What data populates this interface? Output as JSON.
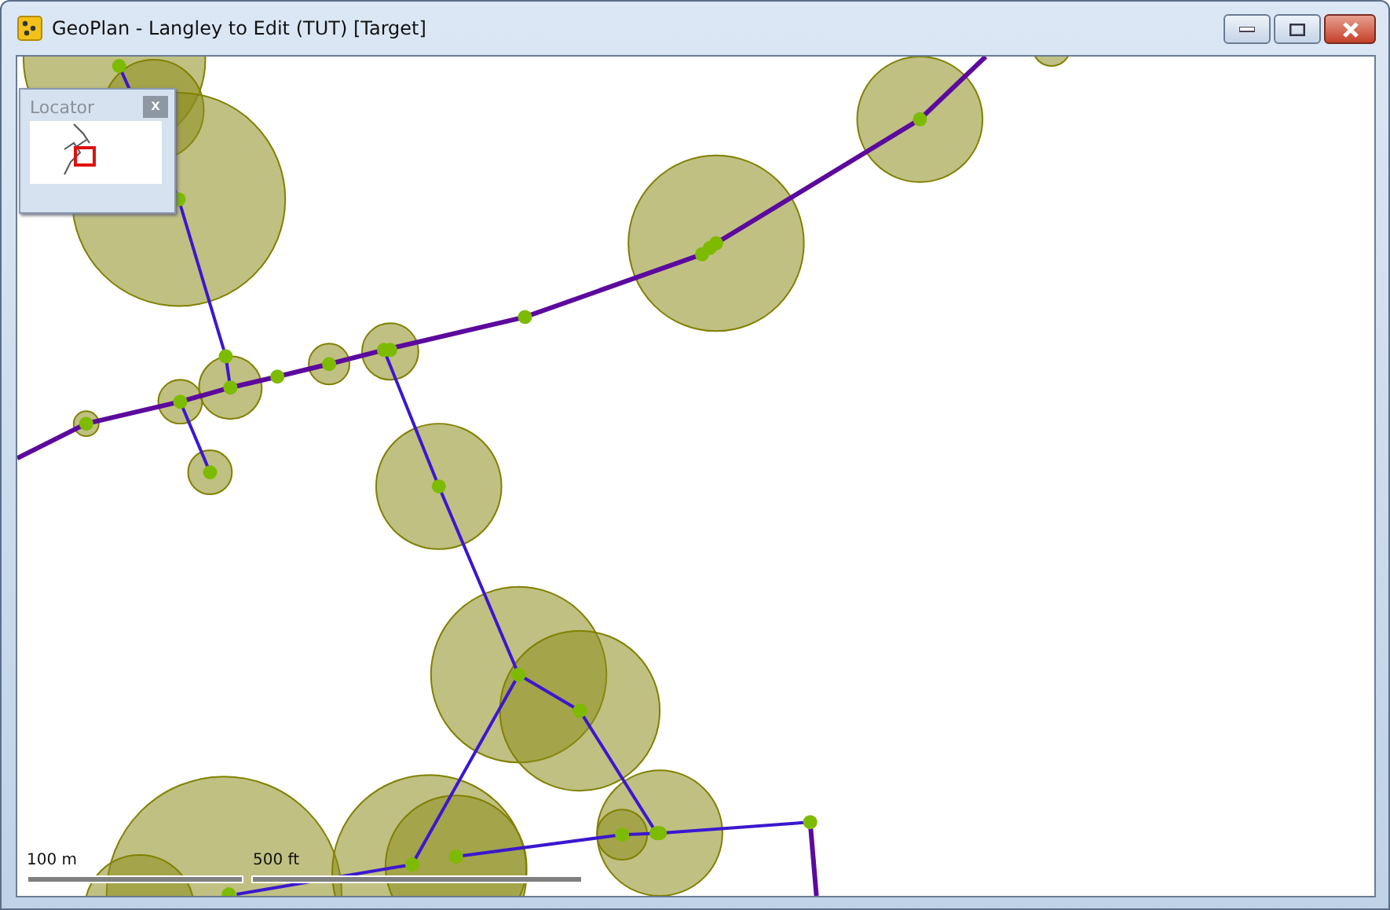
{
  "window": {
    "title": "GeoPlan - Langley to Edit (TUT) [Target]"
  },
  "locator": {
    "title": "Locator",
    "close": "x"
  },
  "scale_bar": {
    "metric_label": "100 m",
    "imperial_label": "500 ft"
  }
}
